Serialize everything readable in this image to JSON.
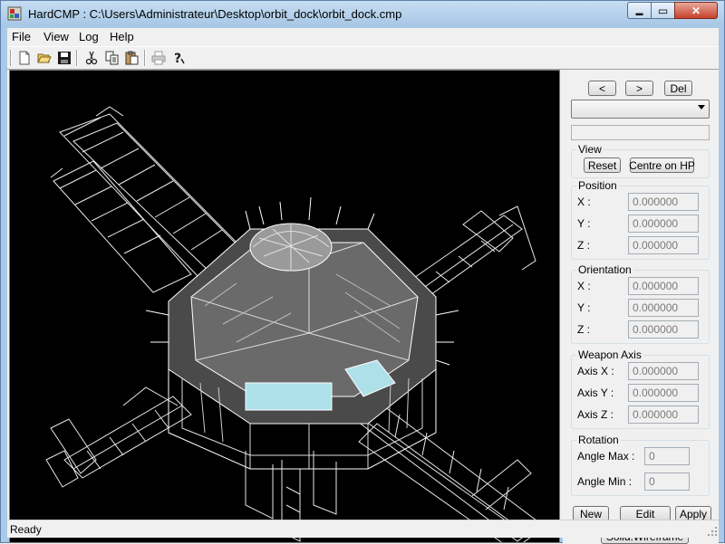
{
  "window": {
    "title": "HardCMP : C:\\Users\\Administrateur\\Desktop\\orbit_dock\\orbit_dock.cmp",
    "min_glyph": "▬",
    "max_glyph": "▭",
    "close_glyph": "✕"
  },
  "menu": {
    "file": "File",
    "view": "View",
    "log": "Log",
    "help": "Help"
  },
  "toolbar": {
    "icons": [
      "new-icon",
      "open-icon",
      "save-icon",
      "cut-icon",
      "copy-icon",
      "paste-icon",
      "print-icon",
      "help-icon"
    ]
  },
  "nav": {
    "prev": "<",
    "next": ">",
    "del": "Del"
  },
  "view_group": {
    "title": "View",
    "reset": "Reset",
    "centre": "Centre on HP"
  },
  "position": {
    "title": "Position",
    "x_label": "X :",
    "y_label": "Y :",
    "z_label": "Z :",
    "x": "0.000000",
    "y": "0.000000",
    "z": "0.000000"
  },
  "orientation": {
    "title": "Orientation",
    "x_label": "X :",
    "y_label": "Y :",
    "z_label": "Z :",
    "x": "0.000000",
    "y": "0.000000",
    "z": "0.000000"
  },
  "weapon_axis": {
    "title": "Weapon Axis",
    "x_label": "Axis X :",
    "y_label": "Axis Y :",
    "z_label": "Axis Z :",
    "x": "0.000000",
    "y": "0.000000",
    "z": "0.000000"
  },
  "rotation": {
    "title": "Rotation",
    "max_label": "Angle Max :",
    "min_label": "Angle Min :",
    "max": "0",
    "min": "0"
  },
  "actions": {
    "new": "New",
    "edit": "Edit",
    "apply": "Apply",
    "render_mode": "Solid.Wireframe"
  },
  "status": {
    "text": "Ready"
  },
  "colors": {
    "viewport_bg": "#000000",
    "wire": "#ffffff",
    "window_frame": "#a9c9e6"
  }
}
